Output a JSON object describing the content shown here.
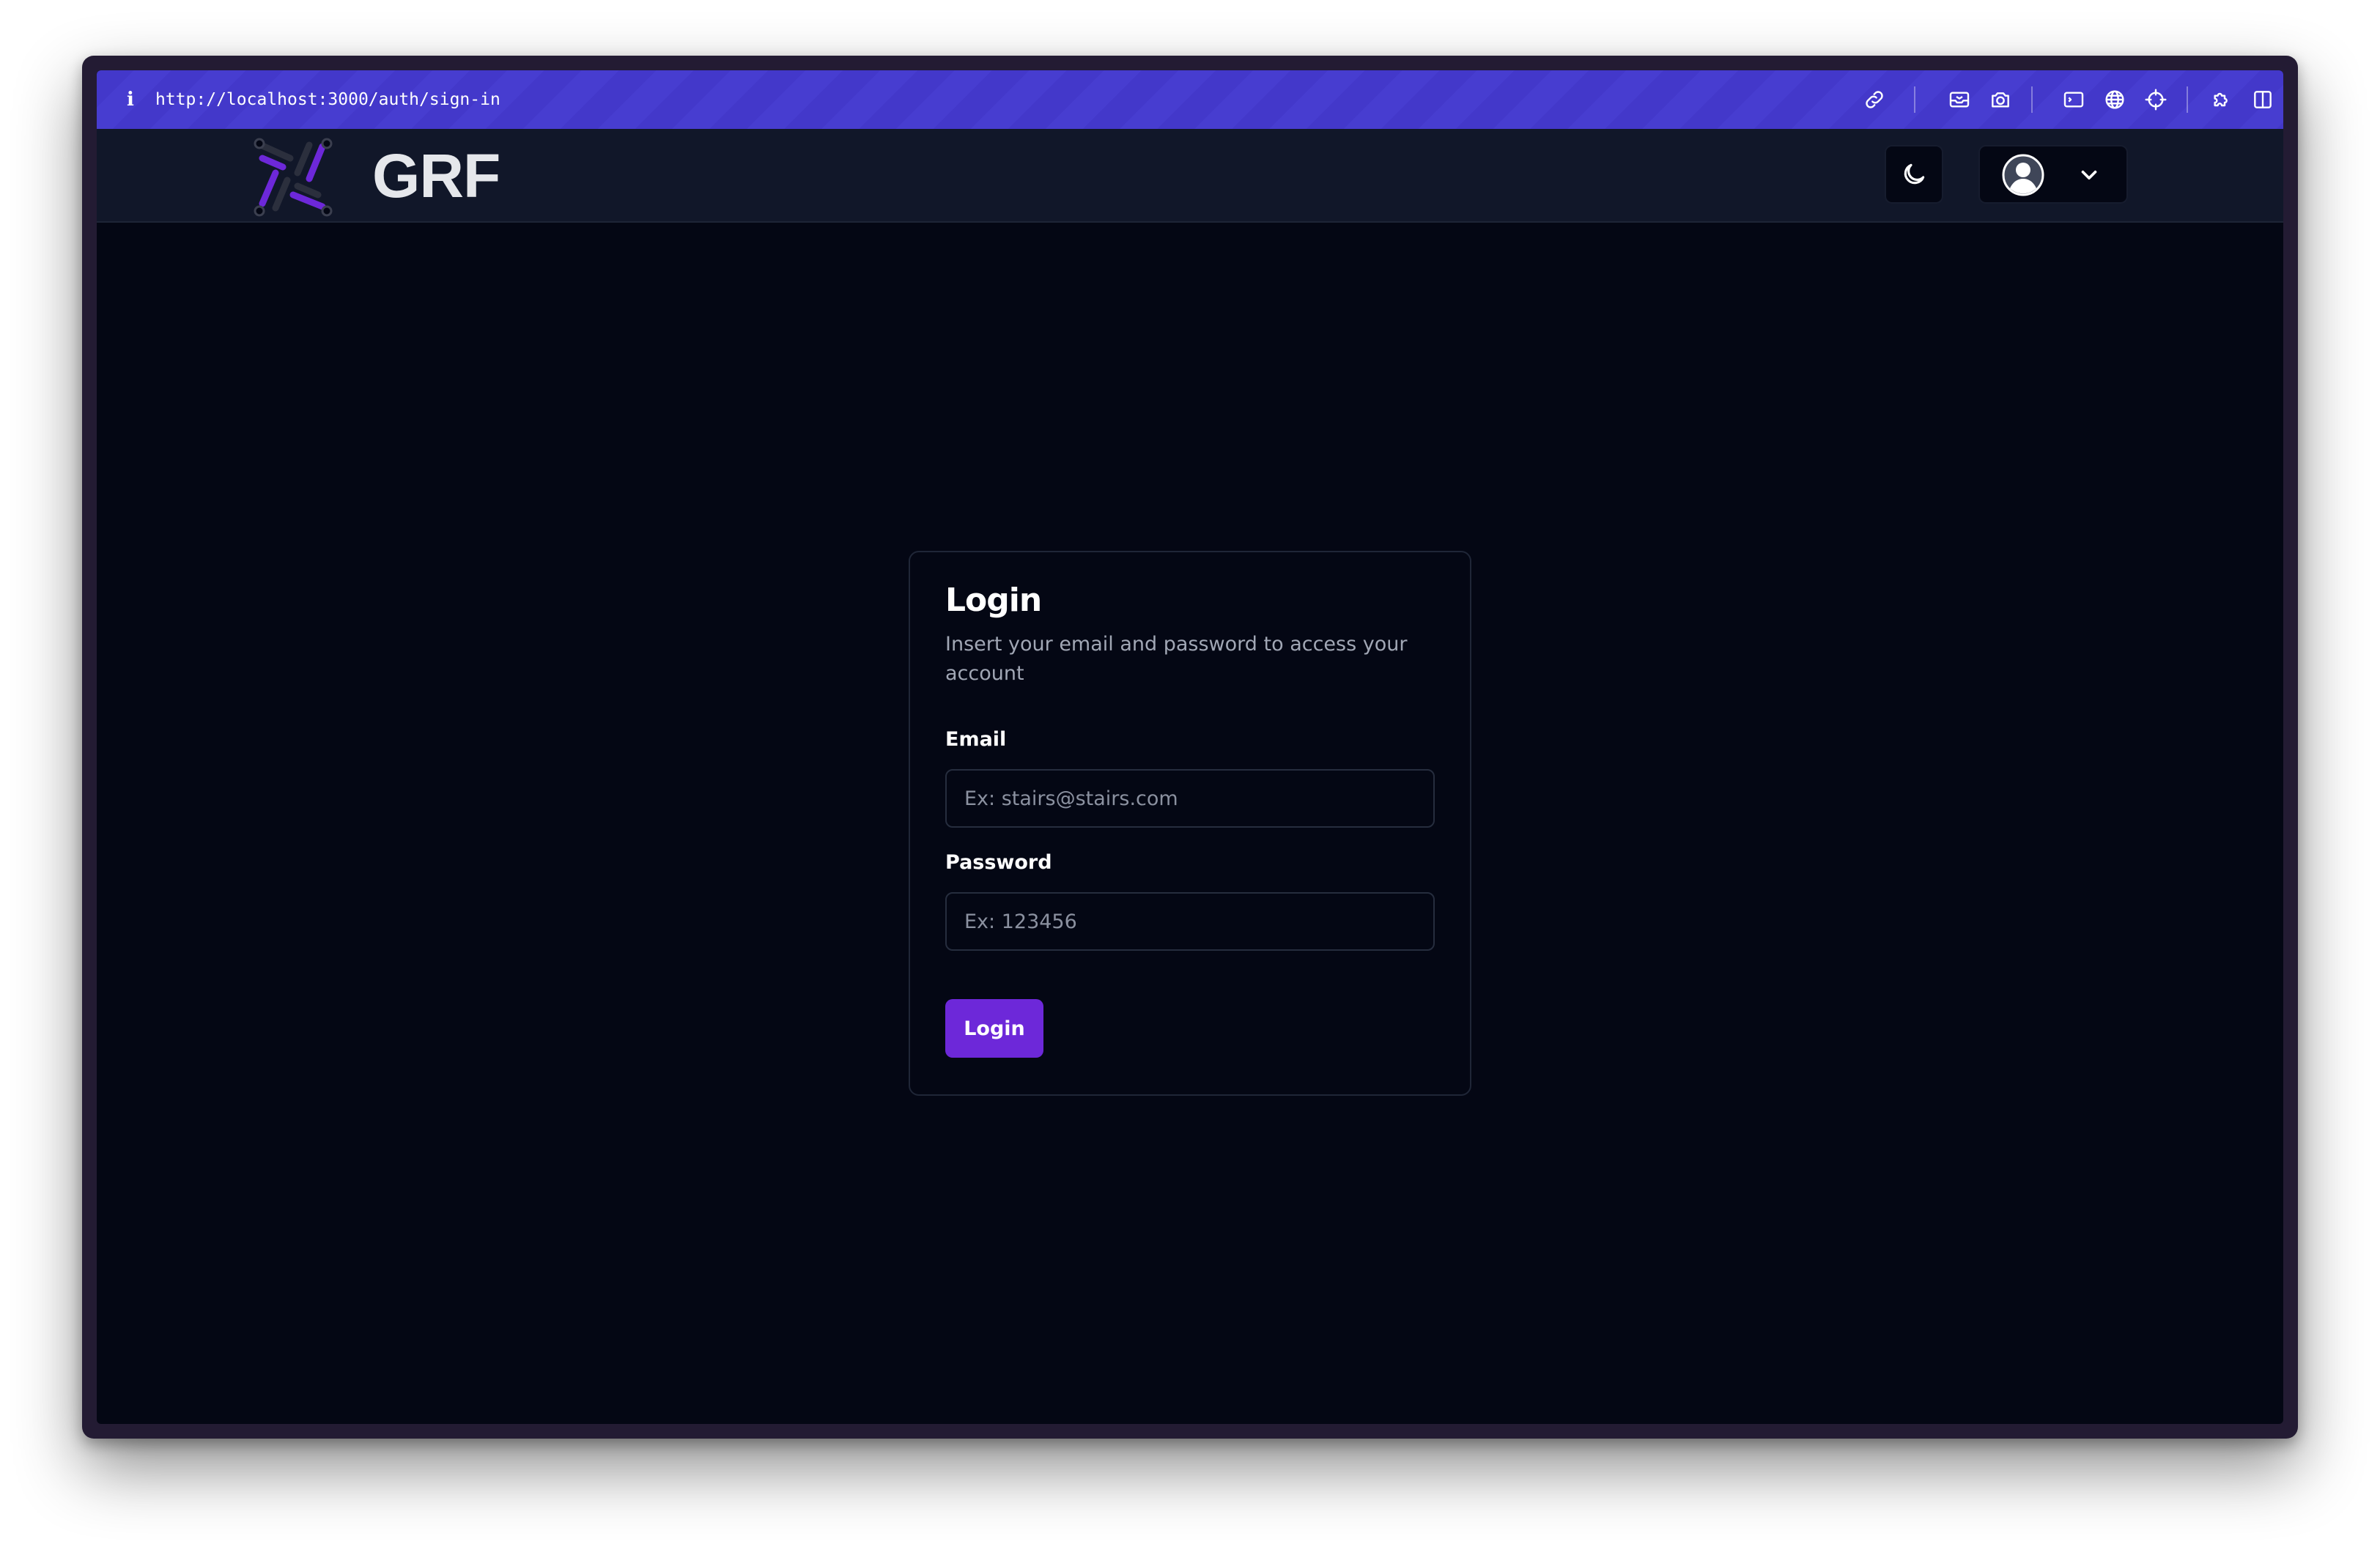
{
  "browser": {
    "info_glyph": "i",
    "url": "http://localhost:3000/auth/sign-in",
    "toolbar_icons": [
      "link-icon",
      "inbox-icon",
      "camera-icon",
      "terminal-icon",
      "globe-icon",
      "crosshair-icon",
      "extension-icon",
      "split-view-icon"
    ]
  },
  "navbar": {
    "brand": "GRF",
    "theme_icon": "moon-icon",
    "user_icon": "user-avatar-icon",
    "menu_icon": "chevron-down-icon"
  },
  "login": {
    "title": "Login",
    "subtitle": "Insert your email and password to access your account",
    "email_label": "Email",
    "email_placeholder": "Ex: stairs@stairs.com",
    "email_value": "",
    "password_label": "Password",
    "password_placeholder": "Ex: 123456",
    "password_value": "",
    "submit_label": "Login"
  },
  "colors": {
    "accent": "#6d28d9",
    "urlbar": "#4338ca",
    "page_bg": "#040714",
    "navbar_bg": "#111729"
  }
}
